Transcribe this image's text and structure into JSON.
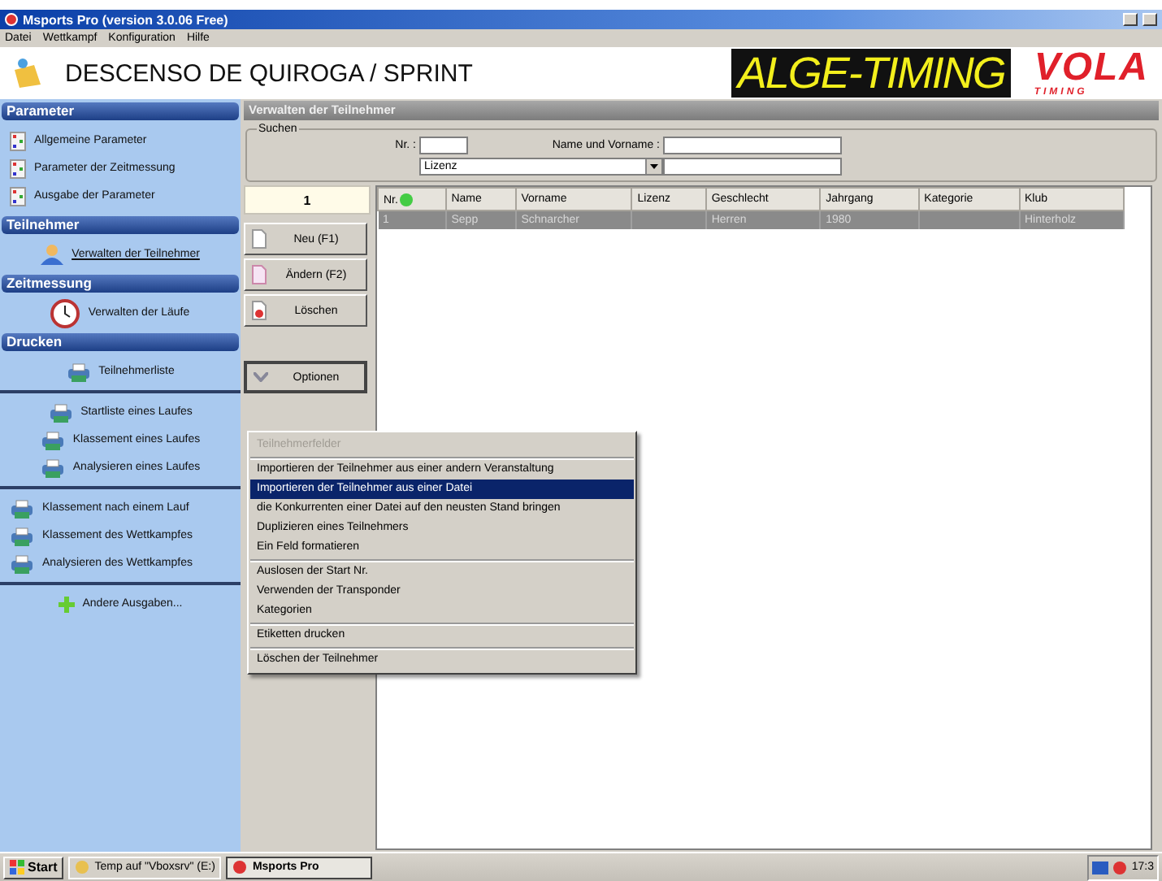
{
  "window": {
    "title": "Msports Pro (version 3.0.06 Free)"
  },
  "menu": [
    "Datei",
    "Wettkampf",
    "Konfiguration",
    "Hilfe"
  ],
  "event_title": "DESCENSO DE QUIROGA / SPRINT",
  "logos": {
    "alge": "ALGE-TIMING",
    "vola": "VOLA",
    "vola_sub": "TIMING"
  },
  "sidebar": {
    "sections": [
      {
        "title": "Parameter",
        "groups": [
          [
            {
              "label": "Allgemeine Parameter",
              "kind": "params",
              "link": false
            },
            {
              "label": "Parameter der Zeitmessung",
              "kind": "params",
              "link": false
            },
            {
              "label": "Ausgabe der Parameter",
              "kind": "params",
              "link": false
            }
          ]
        ]
      },
      {
        "title": "Teilnehmer",
        "groups": [
          [
            {
              "label": "Verwalten der Teilnehmer",
              "kind": "person",
              "link": true
            }
          ]
        ]
      },
      {
        "title": "Zeitmessung",
        "groups": [
          [
            {
              "label": "Verwalten der Läufe",
              "kind": "clock",
              "link": false
            }
          ]
        ]
      },
      {
        "title": "Drucken",
        "groups": [
          [
            {
              "label": "Teilnehmerliste",
              "kind": "printer",
              "link": false
            }
          ],
          [
            {
              "label": "Startliste eines Laufes",
              "kind": "printer",
              "link": false
            },
            {
              "label": "Klassement eines Laufes",
              "kind": "printer",
              "link": false
            },
            {
              "label": "Analysieren eines Laufes",
              "kind": "printer",
              "link": false
            }
          ],
          [
            {
              "label": "Klassement nach einem Lauf",
              "kind": "printer",
              "link": false
            },
            {
              "label": "Klassement des Wettkampfes",
              "kind": "printer",
              "link": false
            },
            {
              "label": "Analysieren des Wettkampfes",
              "kind": "printer",
              "link": false
            }
          ],
          [
            {
              "label": "Andere Ausgaben...",
              "kind": "plus",
              "link": false
            }
          ]
        ]
      }
    ]
  },
  "panel_title": "Verwalten der Teilnehmer",
  "search": {
    "legend": "Suchen",
    "nr_label": "Nr. :",
    "name_label": "Name und Vorname :",
    "dropdown_value": "Lizenz"
  },
  "count": "1",
  "buttons": [
    {
      "label": "Neu (F1)",
      "kind": "new"
    },
    {
      "label": "Ändern (F2)",
      "kind": "edit"
    },
    {
      "label": "Löschen",
      "kind": "delete"
    }
  ],
  "options_button": "Optionen",
  "table": {
    "columns": [
      "Nr.",
      "Name",
      "Vorname",
      "Lizenz",
      "Geschlecht",
      "Jahrgang",
      "Kategorie",
      "Klub"
    ],
    "rows": [
      {
        "cells": [
          "1",
          "Sepp",
          "Schnarcher",
          "",
          "Herren",
          "1980",
          "",
          "Hinterholz"
        ],
        "selected": true
      }
    ]
  },
  "context_menu": {
    "groups": [
      [
        {
          "label": "Teilnehmerfelder",
          "disabled": true,
          "selected": false
        }
      ],
      [
        {
          "label": "Importieren der Teilnehmer aus einer andern Veranstaltung",
          "disabled": false,
          "selected": false
        },
        {
          "label": "Importieren der Teilnehmer aus einer Datei",
          "disabled": false,
          "selected": true
        },
        {
          "label": "die Konkurrenten einer Datei auf den neusten Stand bringen",
          "disabled": false,
          "selected": false
        },
        {
          "label": "Duplizieren eines Teilnehmers",
          "disabled": false,
          "selected": false
        },
        {
          "label": "Ein Feld formatieren",
          "disabled": false,
          "selected": false
        }
      ],
      [
        {
          "label": "Auslosen der Start Nr.",
          "disabled": false,
          "selected": false
        },
        {
          "label": "Verwenden der Transponder",
          "disabled": false,
          "selected": false
        },
        {
          "label": "Kategorien",
          "disabled": false,
          "selected": false
        }
      ],
      [
        {
          "label": "Etiketten drucken",
          "disabled": false,
          "selected": false
        }
      ],
      [
        {
          "label": "Löschen der Teilnehmer",
          "disabled": false,
          "selected": false
        }
      ]
    ]
  },
  "taskbar": {
    "start": "Start",
    "tasks": [
      {
        "label": "Temp auf \"Vboxsrv\" (E:)",
        "active": false
      },
      {
        "label": "Msports Pro",
        "active": true
      }
    ],
    "clock": "17:3"
  }
}
